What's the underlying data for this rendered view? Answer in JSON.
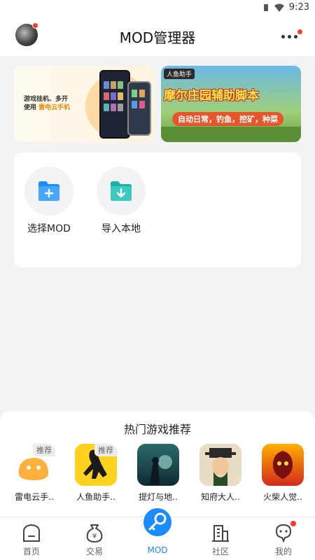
{
  "status_bar": {
    "time": "9:23"
  },
  "header": {
    "title": "MOD管理器"
  },
  "banners": {
    "left": {
      "line1": "游戏挂机、多开",
      "line2_prefix": "使用 ",
      "line2_highlight": "雷电云手机"
    },
    "right": {
      "tag": "人鱼助手",
      "headline": "摩尔庄园辅助脚本",
      "subline": "自动日常，钓鱼，挖矿，种菜"
    }
  },
  "actions": [
    {
      "label": "选择MOD",
      "icon": "folder-plus-icon"
    },
    {
      "label": "导入本地",
      "icon": "folder-download-icon"
    }
  ],
  "hot_games": {
    "heading": "热门游戏推荐",
    "items": [
      {
        "name": "雷电云手..",
        "badge": "推荐",
        "color": "#ffffff"
      },
      {
        "name": "人鱼助手..",
        "badge": "推荐",
        "color": "#ffd21f"
      },
      {
        "name": "提灯与地..",
        "badge": "",
        "color": "#1f4a4a"
      },
      {
        "name": "知府大人..",
        "badge": "",
        "color": "#e8dcc4"
      },
      {
        "name": "火柴人觉..",
        "badge": "",
        "color": "#d2291c"
      }
    ]
  },
  "tabbar": {
    "items": [
      {
        "label": "首页",
        "icon": "home-icon"
      },
      {
        "label": "交易",
        "icon": "moneybag-icon"
      },
      {
        "label": "MOD",
        "icon": "key-icon"
      },
      {
        "label": "社区",
        "icon": "building-icon"
      },
      {
        "label": "我的",
        "icon": "profile-icon"
      }
    ]
  },
  "colors": {
    "accent": "#1a8cff",
    "notification": "#ff3b30",
    "background": "#f2f3f5"
  }
}
